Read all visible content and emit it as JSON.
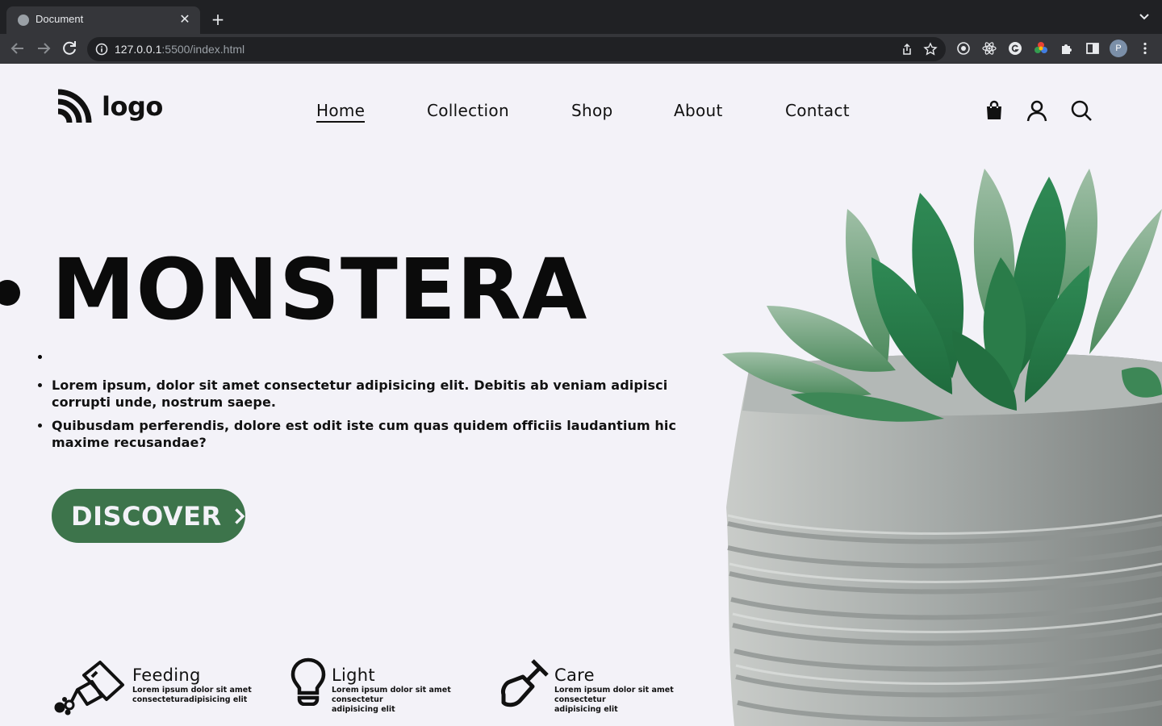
{
  "browser": {
    "tab_title": "Document",
    "new_tab": "+",
    "close_glyph": "✕",
    "url_host": "127.0.0.1",
    "url_rest": ":5500/index.html",
    "profile_initial": "P"
  },
  "header": {
    "logo_text": "logo",
    "nav": [
      "Home",
      "Collection",
      "Shop",
      "About",
      "Contact"
    ],
    "active_nav": "Home",
    "icons": [
      "shopping-bag-icon",
      "user-icon",
      "search-icon"
    ]
  },
  "hero": {
    "title": "MONSTERA",
    "paragraphs": [
      "Lorem ipsum, dolor sit amet consectetur adipisicing elit. Debitis ab veniam adipisci corrupti unde, nostrum saepe.",
      "Quibusdam perferendis, dolore est odit iste cum quas quidem officiis laudantium hic maxime recusandae?"
    ],
    "button_label": "DISCOVER"
  },
  "features": [
    {
      "icon": "watering-can-icon",
      "title": "Feeding",
      "desc_line1": "Lorem ipsum dolor sit amet",
      "desc_line2": "consecteturadipisicing elit"
    },
    {
      "icon": "light-bulb-icon",
      "title": "Light",
      "desc_line1": "Lorem ipsum dolor sit amet consectetur",
      "desc_line2": "adipisicing elit"
    },
    {
      "icon": "shovel-icon",
      "title": "Care",
      "desc_line1": "Lorem ipsum dolor sit amet consectetur",
      "desc_line2": "adipisicing elit"
    }
  ],
  "colors": {
    "accent": "#3d744b",
    "background": "#f3f2f8",
    "text": "#111111"
  }
}
